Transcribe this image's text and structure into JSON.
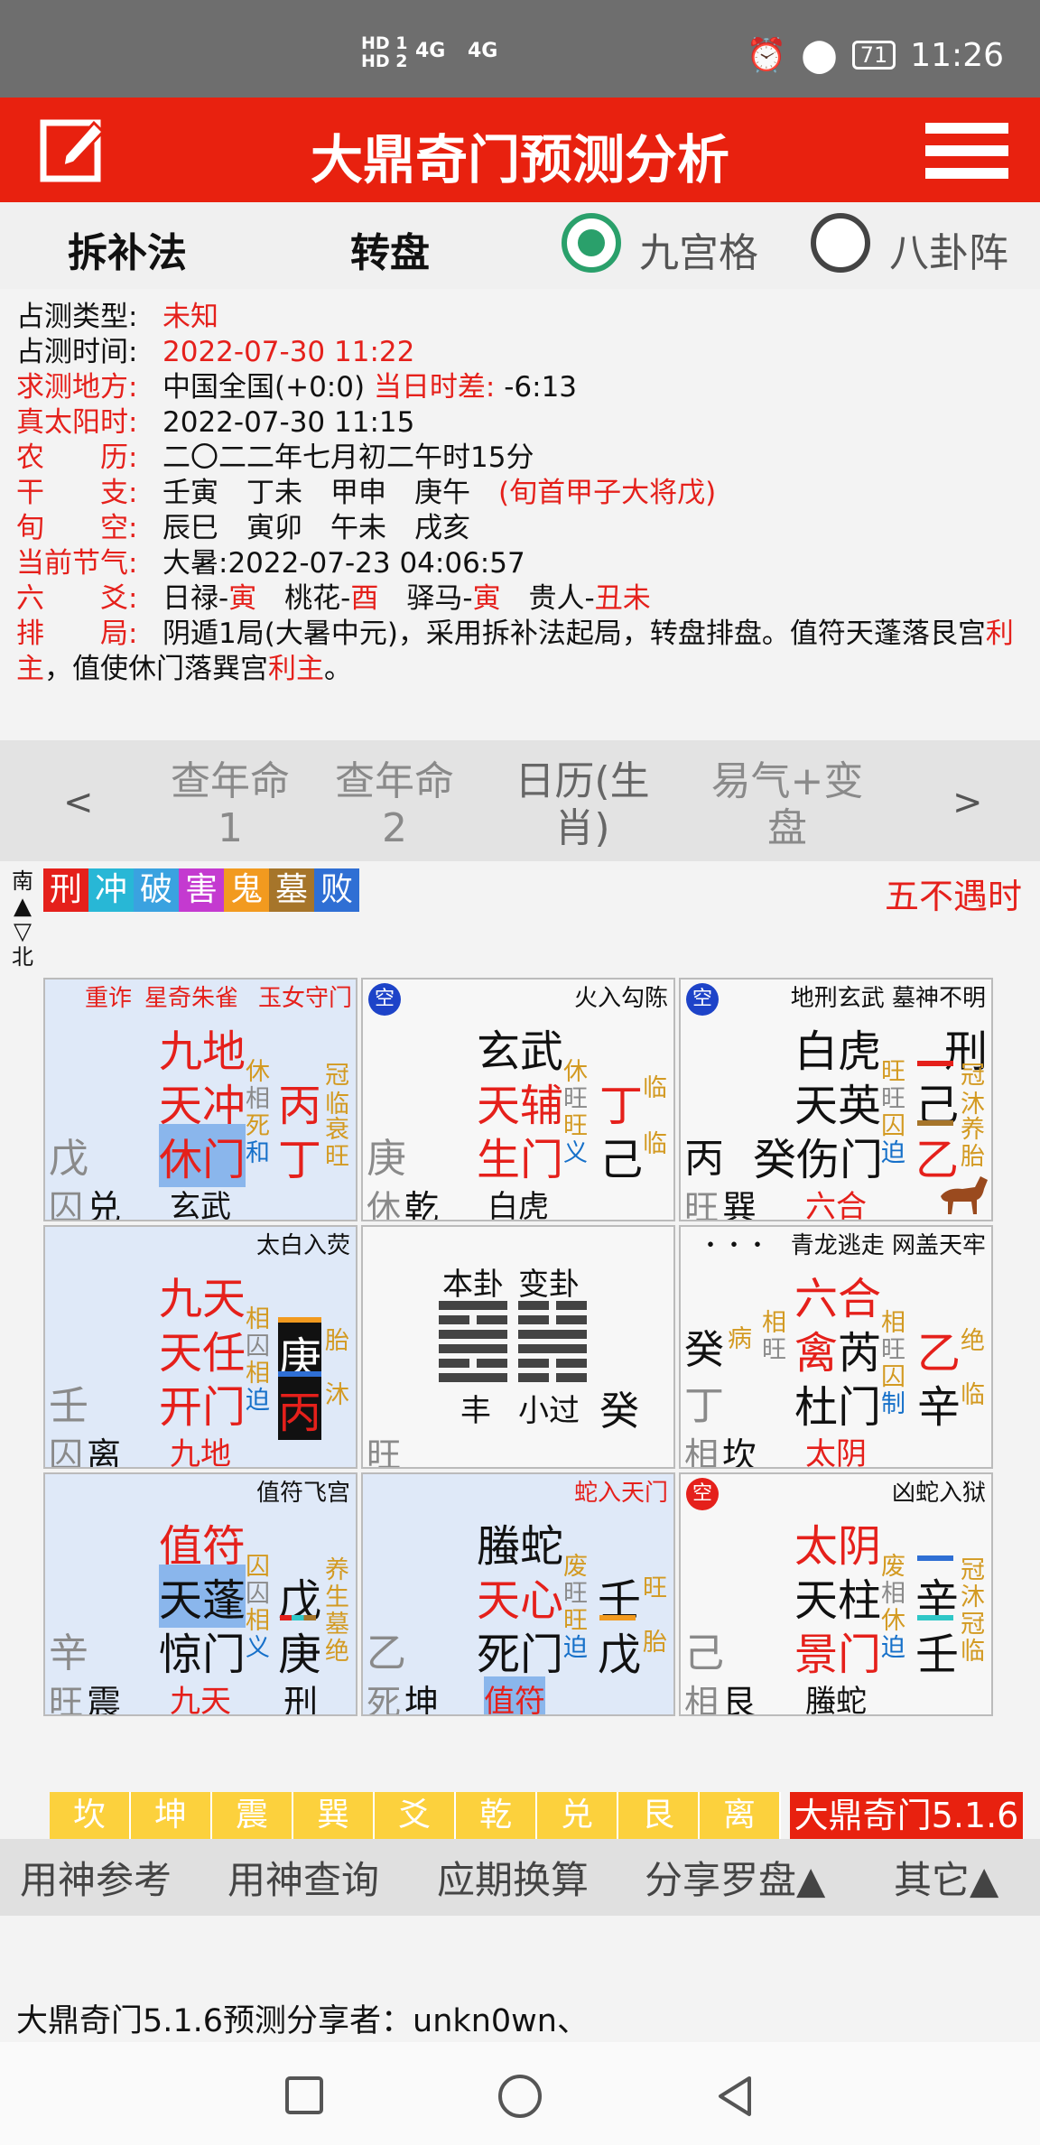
{
  "status": {
    "sig1": "HD 1",
    "sig2": "HD 2",
    "net1": "4G",
    "net2": "4G",
    "battery": "71",
    "time": "11:26"
  },
  "app": {
    "title": "大鼎奇门预测分析"
  },
  "modes": {
    "method": "拆补法",
    "plate": "转盘",
    "option1": "九宫格",
    "option2": "八卦阵"
  },
  "info": {
    "type_label": "占测类型:",
    "type_value": "未知",
    "time_label": "占测时间:",
    "time_value": "2022-07-30 11:22",
    "place_label": "求测地方:",
    "place_value": "中国全国(+0:0)",
    "diff_label": "当日时差:",
    "diff_value": "-6:13",
    "solar_label": "真太阳时:",
    "solar_value": "2022-07-30 11:15",
    "lunar_label": "农　　历:",
    "lunar_value": "二〇二二年七月初二午时15分",
    "ganzhi_label": "干　　支:",
    "ganzhi_value": "壬寅　丁未　甲申　庚午",
    "ganzhi_note": "(旬首甲子大将戊)",
    "xunkong_label": "旬　　空:",
    "xunkong_value": "辰巳　寅卯　午未　戌亥",
    "jieqi_label": "当前节气:",
    "jieqi_value": "大暑:2022-07-23 04:06:57",
    "liuyao_label": "六　　爻:",
    "liuyao_a": "日禄-",
    "liuyao_a_v": "寅",
    "liuyao_b": "　桃花-",
    "liuyao_b_v": "酉",
    "liuyao_c": "　驿马-",
    "liuyao_c_v": "寅",
    "liuyao_d": "　贵人-",
    "liuyao_d_v": "丑未",
    "paiju_label": "排　　局:",
    "paiju_text1": "阴遁1局(大暑中元)，采用拆补法起局，转盘排盘。值符天蓬落艮宫",
    "paiju_red1": "利主",
    "paiju_text2": "，值使休门落巽宫",
    "paiju_red2": "利主",
    "paiju_text3": "。"
  },
  "tabs": {
    "prev": "<",
    "next": ">",
    "t1a": "查年命",
    "t1b": "1",
    "t2a": "查年命",
    "t2b": "2",
    "t3a": "日历(生",
    "t3b": "肖)",
    "t4a": "易气+变",
    "t4b": "盘"
  },
  "chips": [
    {
      "label": "刑",
      "color": "#e5201b"
    },
    {
      "label": "冲",
      "color": "#28b7d6"
    },
    {
      "label": "破",
      "color": "#3aa2e0"
    },
    {
      "label": "害",
      "color": "#c43ad0"
    },
    {
      "label": "鬼",
      "color": "#f29a1f"
    },
    {
      "label": "墓",
      "color": "#a6752a"
    },
    {
      "label": "败",
      "color": "#2f6fd4"
    }
  ],
  "wubuyu": "五不遇时",
  "compass": {
    "south": "南",
    "north": "北"
  },
  "cells": {
    "xun": {
      "note1": "重诈",
      "note2": "星奇朱雀",
      "note3": "玉女守门",
      "god": "九地",
      "star": "天冲",
      "door": "休门",
      "s1": "休",
      "s2": "相",
      "s3": "死",
      "s4": "和",
      "g1": "丙",
      "g2": "丁",
      "c1": "冠",
      "c2": "临",
      "c3": "衰",
      "c4": "旺",
      "left_stem": "戊",
      "bl1": "囚",
      "bl2": "兑",
      "bottom": "玄武"
    },
    "li": {
      "kong": "空",
      "note": "火入勾陈",
      "god": "玄武",
      "star": "天辅",
      "door": "生门",
      "s1": "休",
      "s2": "旺",
      "s3": "旺",
      "s4": "义",
      "g1": "丁",
      "g2": "己",
      "c1": "临",
      "c2": "临",
      "left_stem": "庚",
      "bl1": "休",
      "bl2": "乾",
      "bottom": "白虎"
    },
    "kun": {
      "kong": "空",
      "note": "地刑玄武 墓神不明",
      "god": "白虎",
      "xing": "刑",
      "star": "天英",
      "door": "癸伤门",
      "s1": "旺",
      "s2": "旺",
      "s3": "囚",
      "s4": "迫",
      "g1": "己",
      "g2": "乙",
      "c1": "冠",
      "c2": "沐",
      "c3": "养",
      "c4": "胎",
      "left_stem": "丙",
      "bl1": "旺",
      "bl2": "巽",
      "bottom": "六合"
    },
    "zhen": {
      "note": "太白入荧",
      "god": "九天",
      "star": "天任",
      "door": "开门",
      "s1": "相",
      "s2": "囚",
      "s3": "相",
      "s4": "迫",
      "g1": "庚",
      "g2": "丙",
      "c1": "胎",
      "c2": "沐",
      "left_stem": "壬",
      "bl1": "囚",
      "bl2": "离",
      "bottom": "九地"
    },
    "center": {
      "h1": "本卦",
      "h2": "变卦",
      "g1": "丰",
      "g2": "小过",
      "stem": "癸",
      "state": "旺"
    },
    "dui": {
      "dots": "・・・",
      "note": "青龙逃走 网盖天牢",
      "god": "六合",
      "star_a": "禽",
      "star_b": "芮",
      "door": "杜门",
      "s1": "病",
      "s2": "相",
      "s3": "旺",
      "s4": "相",
      "s5": "旺",
      "s6": "囚",
      "s7": "制",
      "g1": "乙",
      "g2": "辛",
      "c1": "绝",
      "c2": "临",
      "left1": "癸",
      "left2": "丁",
      "bl1": "相",
      "bl2": "坎",
      "bottom": "太阴"
    },
    "gen": {
      "note": "值符飞宫",
      "god": "值符",
      "star": "天蓬",
      "door": "惊门",
      "s1": "囚",
      "s2": "囚",
      "s3": "相",
      "s4": "义",
      "g1": "戊",
      "g2": "庚",
      "c1": "养",
      "c2": "生",
      "c3": "墓",
      "c4": "绝",
      "left_stem": "辛",
      "bl1": "旺",
      "bl2": "震",
      "bottom": "九天",
      "bottom2": "刑"
    },
    "kan": {
      "note": "蛇入天门",
      "god": "螣蛇",
      "star": "天心",
      "door": "死门",
      "s1": "废",
      "s2": "旺",
      "s3": "旺",
      "s4": "迫",
      "g1": "壬",
      "g2": "戊",
      "c1": "旺",
      "c2": "胎",
      "left_stem": "乙",
      "bl1": "死",
      "bl2": "坤",
      "bottom": "值符"
    },
    "qian": {
      "kong": "空",
      "note": "凶蛇入狱",
      "god": "太阴",
      "star": "天柱",
      "door": "景门",
      "s1": "废",
      "s2": "相",
      "s3": "休",
      "s4": "迫",
      "g1": "辛",
      "g2": "壬",
      "c1": "冠",
      "c2": "沐",
      "c3": "冠",
      "c4": "临",
      "left_stem": "己",
      "bl1": "相",
      "bl2": "艮",
      "bottom": "螣蛇"
    }
  },
  "bagua": [
    "坎",
    "坤",
    "震",
    "巽",
    "爻",
    "乾",
    "兑",
    "艮",
    "离"
  ],
  "brand": "大鼎奇门5.1.6",
  "toolbar": {
    "t1": "用神参考",
    "t2": "用神查询",
    "t3": "应期换算",
    "t4": "分享罗盘▲",
    "t5": "其它▲"
  },
  "share": "大鼎奇门5.1.6预测分享者：unkn0wn、"
}
